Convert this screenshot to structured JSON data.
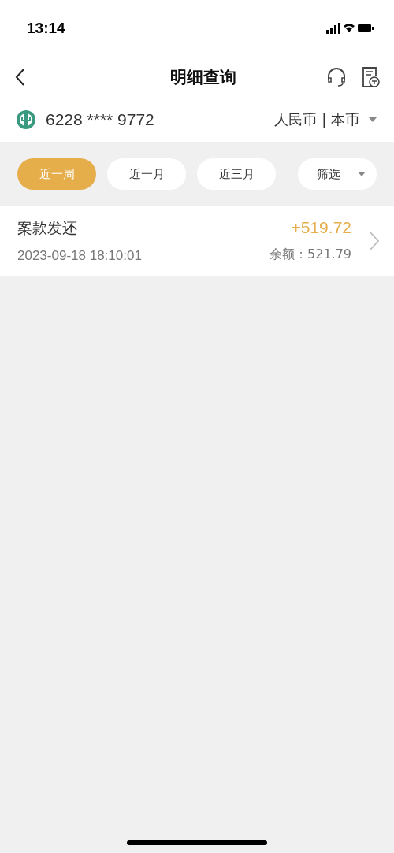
{
  "status_bar": {
    "time": "13:14"
  },
  "nav": {
    "title": "明细查询"
  },
  "account": {
    "number": "6228 **** 9772",
    "currency": "人民币 | 本币"
  },
  "filters": [
    {
      "label": "近一周",
      "selected": true
    },
    {
      "label": "近一月",
      "selected": false
    },
    {
      "label": "近三月",
      "selected": false
    }
  ],
  "filter_dropdown": {
    "label": "筛选"
  },
  "transactions": [
    {
      "title": "案款发还",
      "amount": "+519.72",
      "time": "2023-09-18 18:10:01",
      "balance": "余额：521.79"
    }
  ]
}
